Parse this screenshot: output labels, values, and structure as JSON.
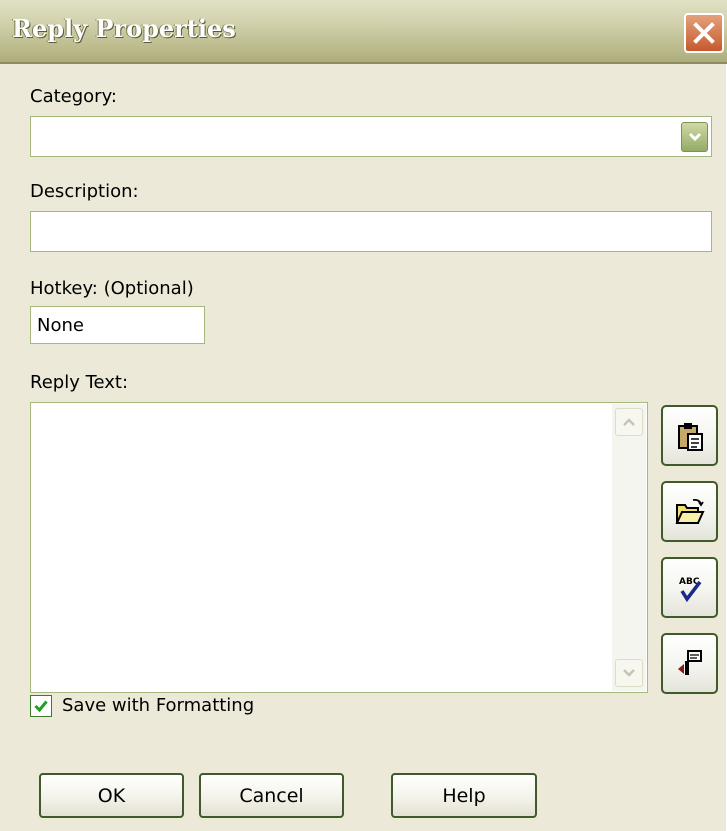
{
  "window": {
    "title": "Reply Properties",
    "close_icon": "close-icon"
  },
  "category": {
    "label": "Category:",
    "value": ""
  },
  "description": {
    "label": "Description:",
    "value": ""
  },
  "hotkey": {
    "label": "Hotkey:  (Optional)",
    "value": "None"
  },
  "reply_text": {
    "label": "Reply Text:",
    "value": ""
  },
  "tools": [
    {
      "name": "paste-icon"
    },
    {
      "name": "open-folder-icon"
    },
    {
      "name": "spell-check-icon"
    },
    {
      "name": "insert-field-icon"
    }
  ],
  "save_formatting": {
    "label": "Save with Formatting",
    "checked": true
  },
  "buttons": {
    "ok": "OK",
    "cancel": "Cancel",
    "help": "Help"
  },
  "colors": {
    "title_bar": "#bcbc8e",
    "dialog_bg": "#ece9d8",
    "close_button": "#c8582c",
    "field_border": "#a5b97f",
    "button_border": "#3f5a2b"
  }
}
